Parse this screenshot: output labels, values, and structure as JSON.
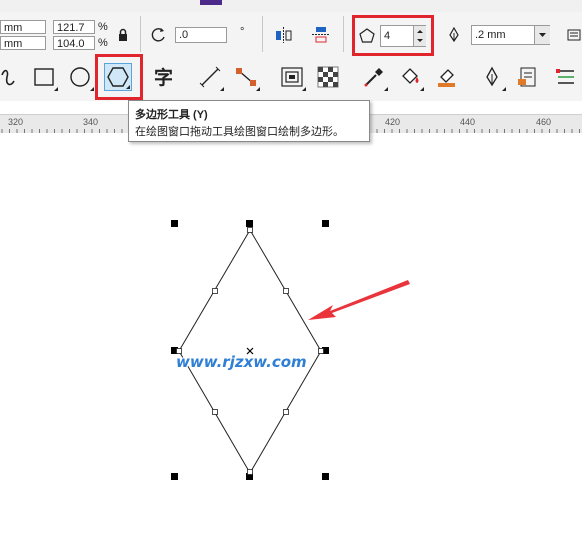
{
  "property_bar": {
    "width_unit": "mm",
    "height_unit": "mm",
    "scale_x": "121.7",
    "scale_y": "104.0",
    "percent_x": "%",
    "percent_y": "%",
    "rotation": ".0",
    "degree_symbol": "°",
    "polygon_points": "4",
    "outline_width": ".2 mm"
  },
  "tooltip": {
    "title": "多边形工具 (Y)",
    "description": "在绘图窗口拖动工具绘图窗口绘制多边形。"
  },
  "ruler": {
    "labels": [
      "320",
      "340",
      "420",
      "440",
      "460"
    ]
  },
  "watermark": "www.rjzxw.com",
  "colors": {
    "highlight_red": "#e0262c",
    "arrow_red": "#e8343a",
    "watermark_blue": "#2f7fd4"
  }
}
